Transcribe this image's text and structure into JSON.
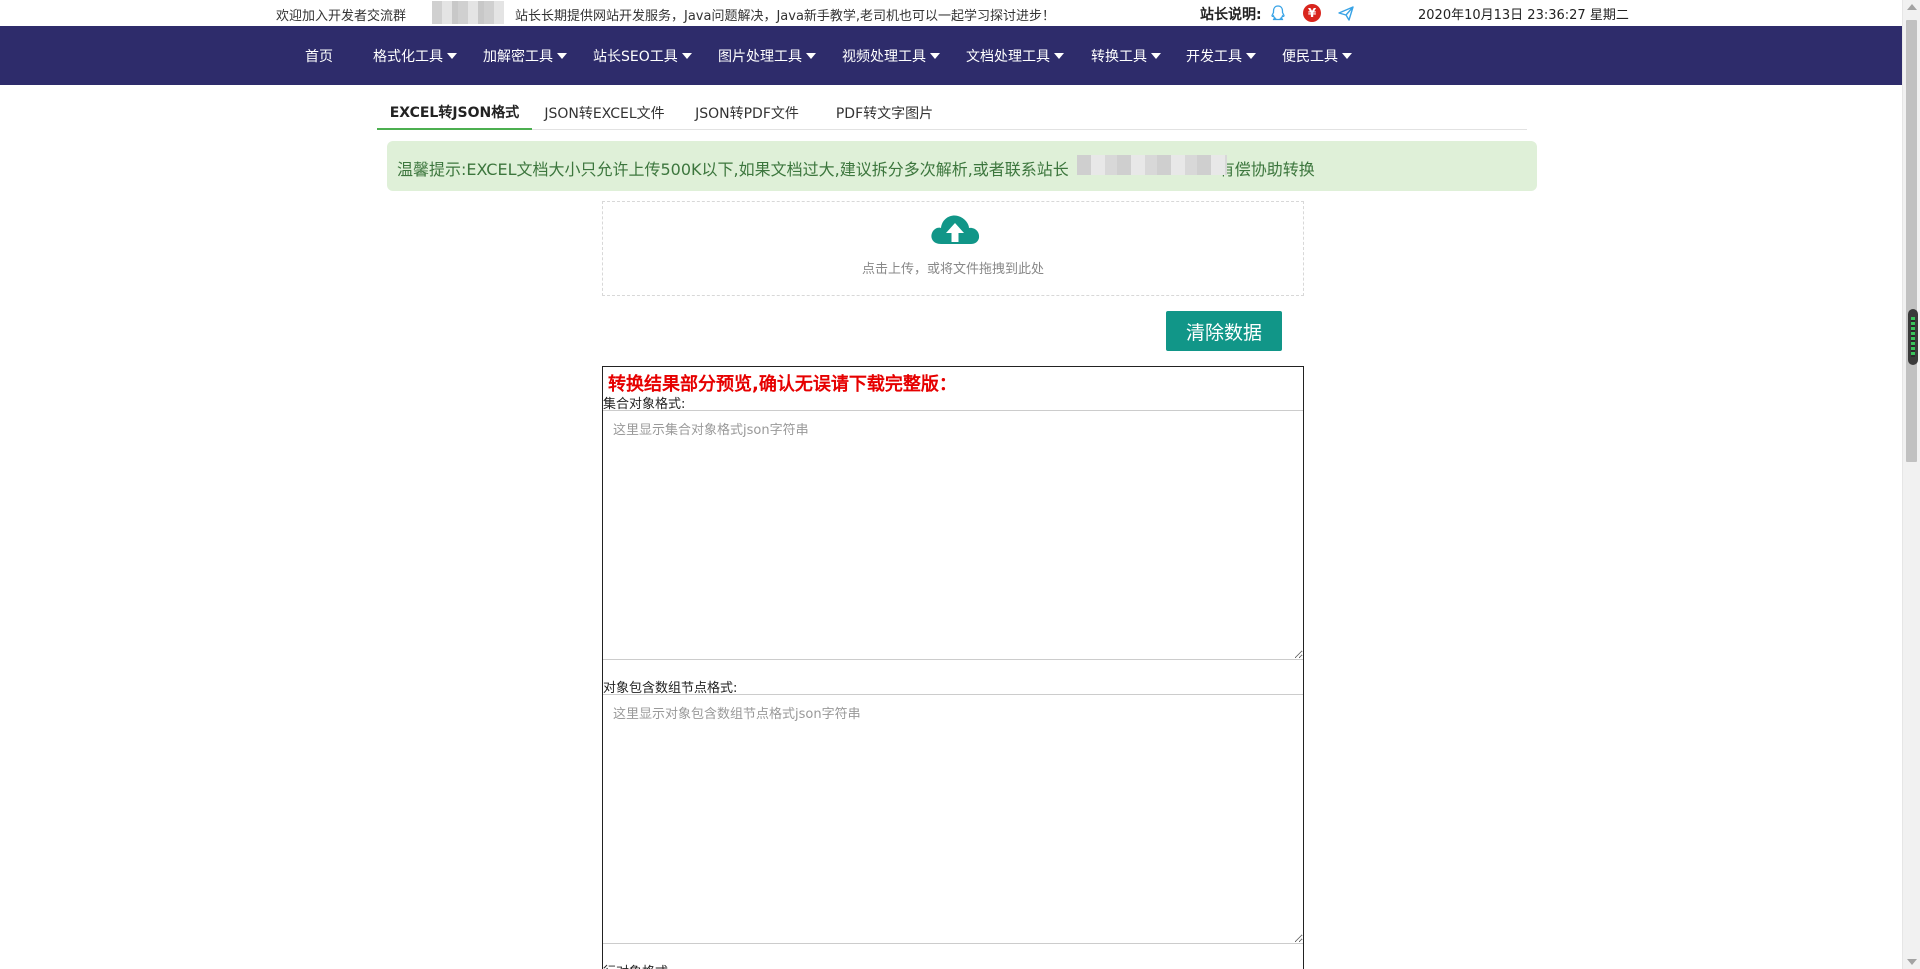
{
  "topbar": {
    "welcome": "欢迎加入开发者交流群",
    "service": "站长长期提供网站开发服务，Java问题解决，Java新手教学,老司机也可以一起学习探讨进步！",
    "owner_label": "站长说明:",
    "yen_symbol": "¥",
    "datetime": "2020年10月13日 23:36:27 星期二"
  },
  "nav": {
    "items": [
      {
        "label": "首页",
        "dropdown": false
      },
      {
        "label": "格式化工具",
        "dropdown": true
      },
      {
        "label": "加解密工具",
        "dropdown": true
      },
      {
        "label": "站长SEO工具",
        "dropdown": true
      },
      {
        "label": "图片处理工具",
        "dropdown": true
      },
      {
        "label": "视频处理工具",
        "dropdown": true
      },
      {
        "label": "文档处理工具",
        "dropdown": true
      },
      {
        "label": "转换工具",
        "dropdown": true
      },
      {
        "label": "开发工具",
        "dropdown": true
      },
      {
        "label": "便民工具",
        "dropdown": true
      }
    ]
  },
  "tabs": [
    {
      "label": "EXCEL转JSON格式",
      "active": true
    },
    {
      "label": "JSON转EXCEL文件",
      "active": false
    },
    {
      "label": "JSON转PDF文件",
      "active": false
    },
    {
      "label": "PDF转文字图片",
      "active": false
    }
  ],
  "notice": {
    "text_before": "温馨提示:EXCEL文档大小只允许上传500K以下,如果文档过大,建议拆分多次解析,或者联系站长",
    "text_after": "有偿协助转换"
  },
  "upload": {
    "hint": "点击上传，或将文件拖拽到此处",
    "icon": "cloud-upload-icon"
  },
  "clear_button": "清除数据",
  "result": {
    "heading": "转换结果部分预览,确认无误请下载完整版：",
    "fields": [
      {
        "label": "集合对象格式:",
        "placeholder": "这里显示集合对象格式json字符串"
      },
      {
        "label": "对象包含数组节点格式:",
        "placeholder": "这里显示对象包含数组节点格式json字符串"
      },
      {
        "label": "行对象格式:"
      }
    ]
  },
  "colors": {
    "nav_bg": "#2e2c6b",
    "accent_green": "#119688",
    "notice_bg": "#dff0d8",
    "heading_red": "#e60000"
  }
}
